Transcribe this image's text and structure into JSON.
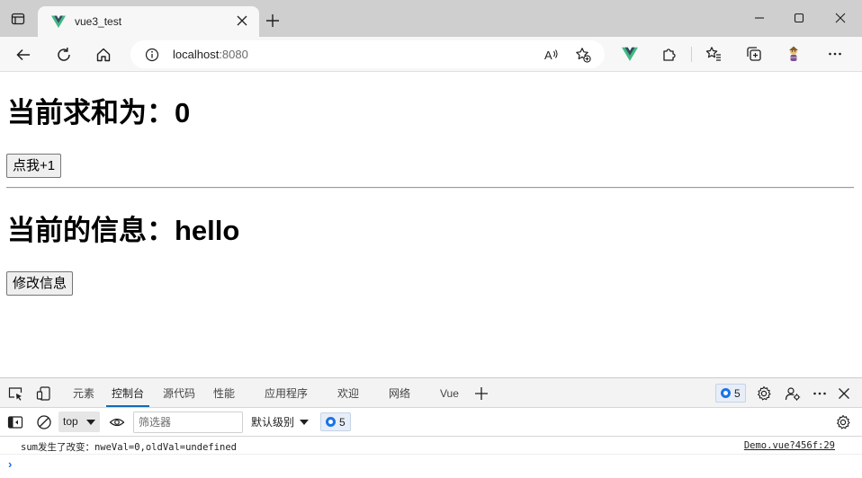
{
  "browser": {
    "tab_title": "vue3_test",
    "url_host": "localhost",
    "url_port": ":8080"
  },
  "page": {
    "sum_heading": "当前求和为：0",
    "sum_button": "点我+1",
    "msg_heading": "当前的信息：hello",
    "msg_button": "修改信息"
  },
  "devtools": {
    "tabs": [
      "元素",
      "控制台",
      "源代码",
      "性能",
      "应用程序",
      "欢迎",
      "网络",
      "Vue"
    ],
    "active_tab": "控制台",
    "issues_count": "5",
    "context": "top",
    "filter_placeholder": "筛选器",
    "level": "默认级别",
    "level_issues_count": "5",
    "console_message": "sum发生了改变：nweVal=0,oldVal=undefined",
    "console_source": "Demo.vue?456f:29",
    "prompt": "›"
  },
  "colors": {
    "vue_green": "#41b883",
    "vue_dark": "#35495e",
    "accent_blue": "#0f6cbd",
    "titlebar_bg": "#cfcfcf"
  },
  "icons": [
    "window-menu-icon",
    "vue-favicon-icon",
    "close-icon",
    "plus-icon",
    "minimize-icon",
    "maximize-icon",
    "back-icon",
    "refresh-icon",
    "home-icon",
    "info-icon",
    "read-aloud-icon",
    "favorite-add-icon",
    "vue-devtools-icon",
    "extensions-icon",
    "favorites-icon",
    "collections-icon",
    "profile-icon",
    "more-icon"
  ]
}
